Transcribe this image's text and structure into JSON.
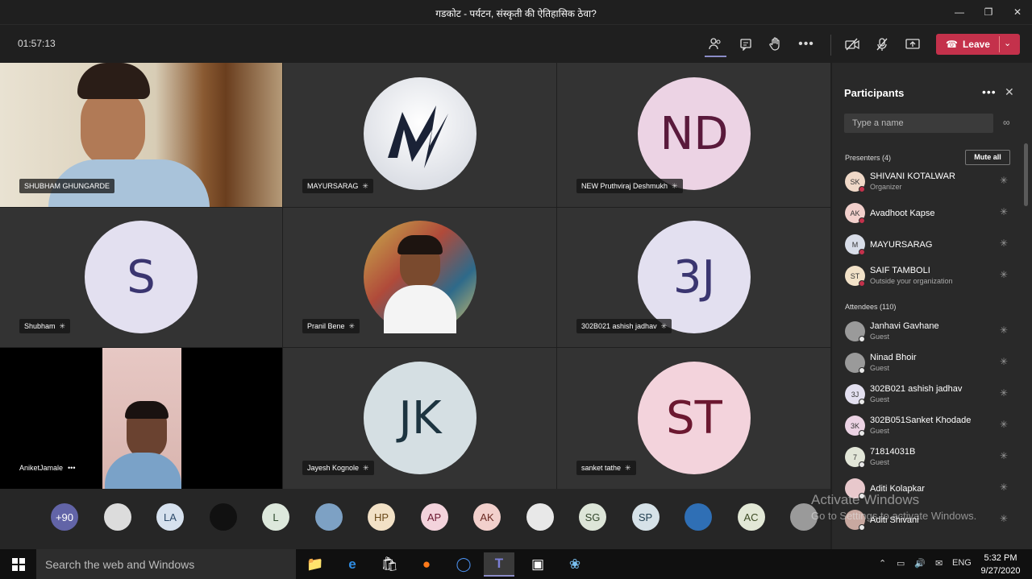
{
  "window": {
    "title": "गडकोट - पर्यटन, संस्कृती की ऐतिहासिक ठेवा?"
  },
  "toolbar": {
    "timer": "01:57:13",
    "leave_label": "Leave"
  },
  "tiles": [
    {
      "name": "SHUBHAM GHUNGARDE",
      "kind": "video"
    },
    {
      "name": "MAYURSARAG",
      "kind": "logo"
    },
    {
      "name": "NEW Pruthviraj Deshmukh",
      "initials": "ND",
      "bg": "#ecd3e4",
      "fg": "#5a1a3c"
    },
    {
      "name": "Shubham",
      "initials": "S",
      "bg": "#e3e0f0",
      "fg": "#3a3570"
    },
    {
      "name": "Pranil Bene",
      "kind": "photo"
    },
    {
      "name": "302B021 ashish jadhav",
      "initials": "3J",
      "bg": "#e3e0f0",
      "fg": "#3a3570"
    },
    {
      "name": "AniketJamale",
      "kind": "video2"
    },
    {
      "name": "Jayesh Kognole",
      "initials": "JK",
      "bg": "#d5dfe3",
      "fg": "#1d3440"
    },
    {
      "name": "sanket tathe",
      "initials": "ST",
      "bg": "#f3d3dc",
      "fg": "#6b1830"
    }
  ],
  "participants": {
    "title": "Participants",
    "search_placeholder": "Type a name",
    "mute_all": "Mute all",
    "presenters_label": "Presenters (4)",
    "attendees_label": "Attendees (110)",
    "presenters": [
      {
        "name": "SHIVANI KOTALWAR",
        "role": "Organizer",
        "initials": "SK",
        "bg": "#f0d9c8"
      },
      {
        "name": "Avadhoot Kapse",
        "role": "",
        "initials": "AK",
        "bg": "#f2d0cc"
      },
      {
        "name": "MAYURSARAG",
        "role": "",
        "initials": "M",
        "bg": "#d8dde8"
      },
      {
        "name": "SAIF TAMBOLI",
        "role": "Outside your organization",
        "initials": "ST",
        "bg": "#f2e2c8"
      }
    ],
    "attendees": [
      {
        "name": "Janhavi Gavhane",
        "role": "Guest",
        "initials": "",
        "bg": "#9a9a9a"
      },
      {
        "name": "Ninad Bhoir",
        "role": "Guest",
        "initials": "",
        "bg": "#9a9a9a"
      },
      {
        "name": "302B021 ashish jadhav",
        "role": "Guest",
        "initials": "3J",
        "bg": "#e3e0f0"
      },
      {
        "name": "302B051Sanket Khodade",
        "role": "Guest",
        "initials": "3K",
        "bg": "#ecd3e4"
      },
      {
        "name": "71814031B",
        "role": "Guest",
        "initials": "7",
        "bg": "#e2e6d8"
      },
      {
        "name": "Aditi Kolapkar",
        "role": "",
        "initials": "",
        "bg": "#e8c8cc"
      },
      {
        "name": "Aditi Shivani",
        "role": "",
        "initials": "",
        "bg": "#c8a8a0"
      }
    ]
  },
  "strip": [
    {
      "label": "+90",
      "bg": "#6264a7",
      "fg": "#ffffff"
    },
    {
      "label": "",
      "bg": "#dcdcdc",
      "fg": "#333"
    },
    {
      "label": "LA",
      "bg": "#d6e1ee",
      "fg": "#2c4a6a"
    },
    {
      "label": "",
      "bg": "#111111",
      "fg": "#c33"
    },
    {
      "label": "L",
      "bg": "#dde8dc",
      "fg": "#2e4a2e"
    },
    {
      "label": "",
      "bg": "#7da1c4",
      "fg": "#333"
    },
    {
      "label": "HP",
      "bg": "#f2e1c6",
      "fg": "#6b4a1a"
    },
    {
      "label": "AP",
      "bg": "#f3d3dc",
      "fg": "#6b1830"
    },
    {
      "label": "AK",
      "bg": "#f2d0cc",
      "fg": "#6b2a22"
    },
    {
      "label": "",
      "bg": "#e8e8e8",
      "fg": "#333"
    },
    {
      "label": "SG",
      "bg": "#dde5d8",
      "fg": "#33462b"
    },
    {
      "label": "SP",
      "bg": "#d6e2e8",
      "fg": "#234152"
    },
    {
      "label": "",
      "bg": "#2f6fb5",
      "fg": "#fff"
    },
    {
      "label": "AC",
      "bg": "#e2e8d6",
      "fg": "#3b4a22"
    },
    {
      "label": "",
      "bg": "#9a9a9a",
      "fg": "#fff"
    }
  ],
  "watermark": {
    "line1": "Activate Windows",
    "line2": "Go to Settings to activate Windows."
  },
  "taskbar": {
    "search_placeholder": "Search the web and Windows",
    "language": "ENG",
    "time": "5:32 PM",
    "date": "9/27/2020"
  }
}
